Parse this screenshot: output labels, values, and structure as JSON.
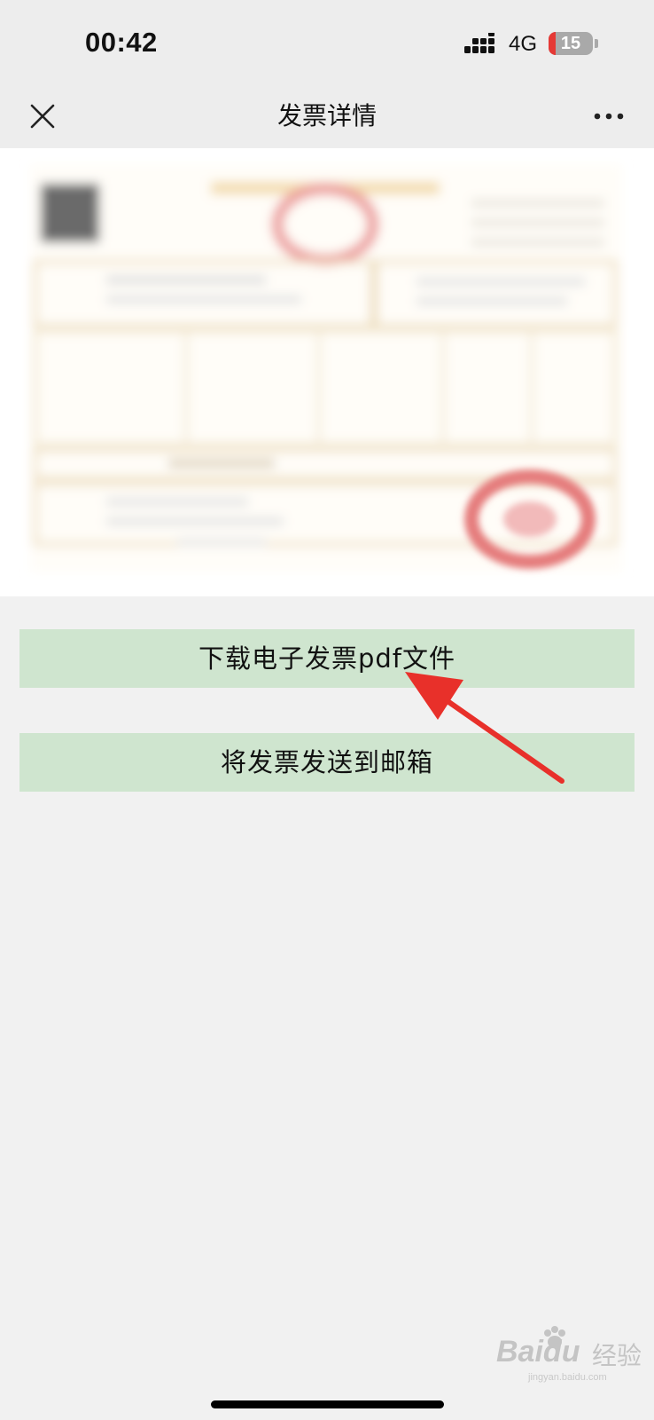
{
  "status_bar": {
    "time": "00:42",
    "network": "4G",
    "battery": {
      "percent": 15,
      "label": "15"
    }
  },
  "nav": {
    "title": "发票详情",
    "close_icon": "close-icon",
    "more_icon": "more-icon"
  },
  "invoice_preview": {
    "state": "blurred"
  },
  "actions": {
    "download_label": "下载电子发票pdf文件",
    "email_label": "将发票发送到邮箱"
  },
  "annotation": {
    "arrow_color": "#e8302a"
  },
  "watermark": {
    "logo": "Bai",
    "logo_tail": "du",
    "text": "经验",
    "url": "jingyan.baidu.com"
  },
  "colors": {
    "page_background": "#f1f1f1",
    "nav_background": "#ededed",
    "button_background": "#cfe5cf",
    "stamp_red": "#e07a7a"
  }
}
